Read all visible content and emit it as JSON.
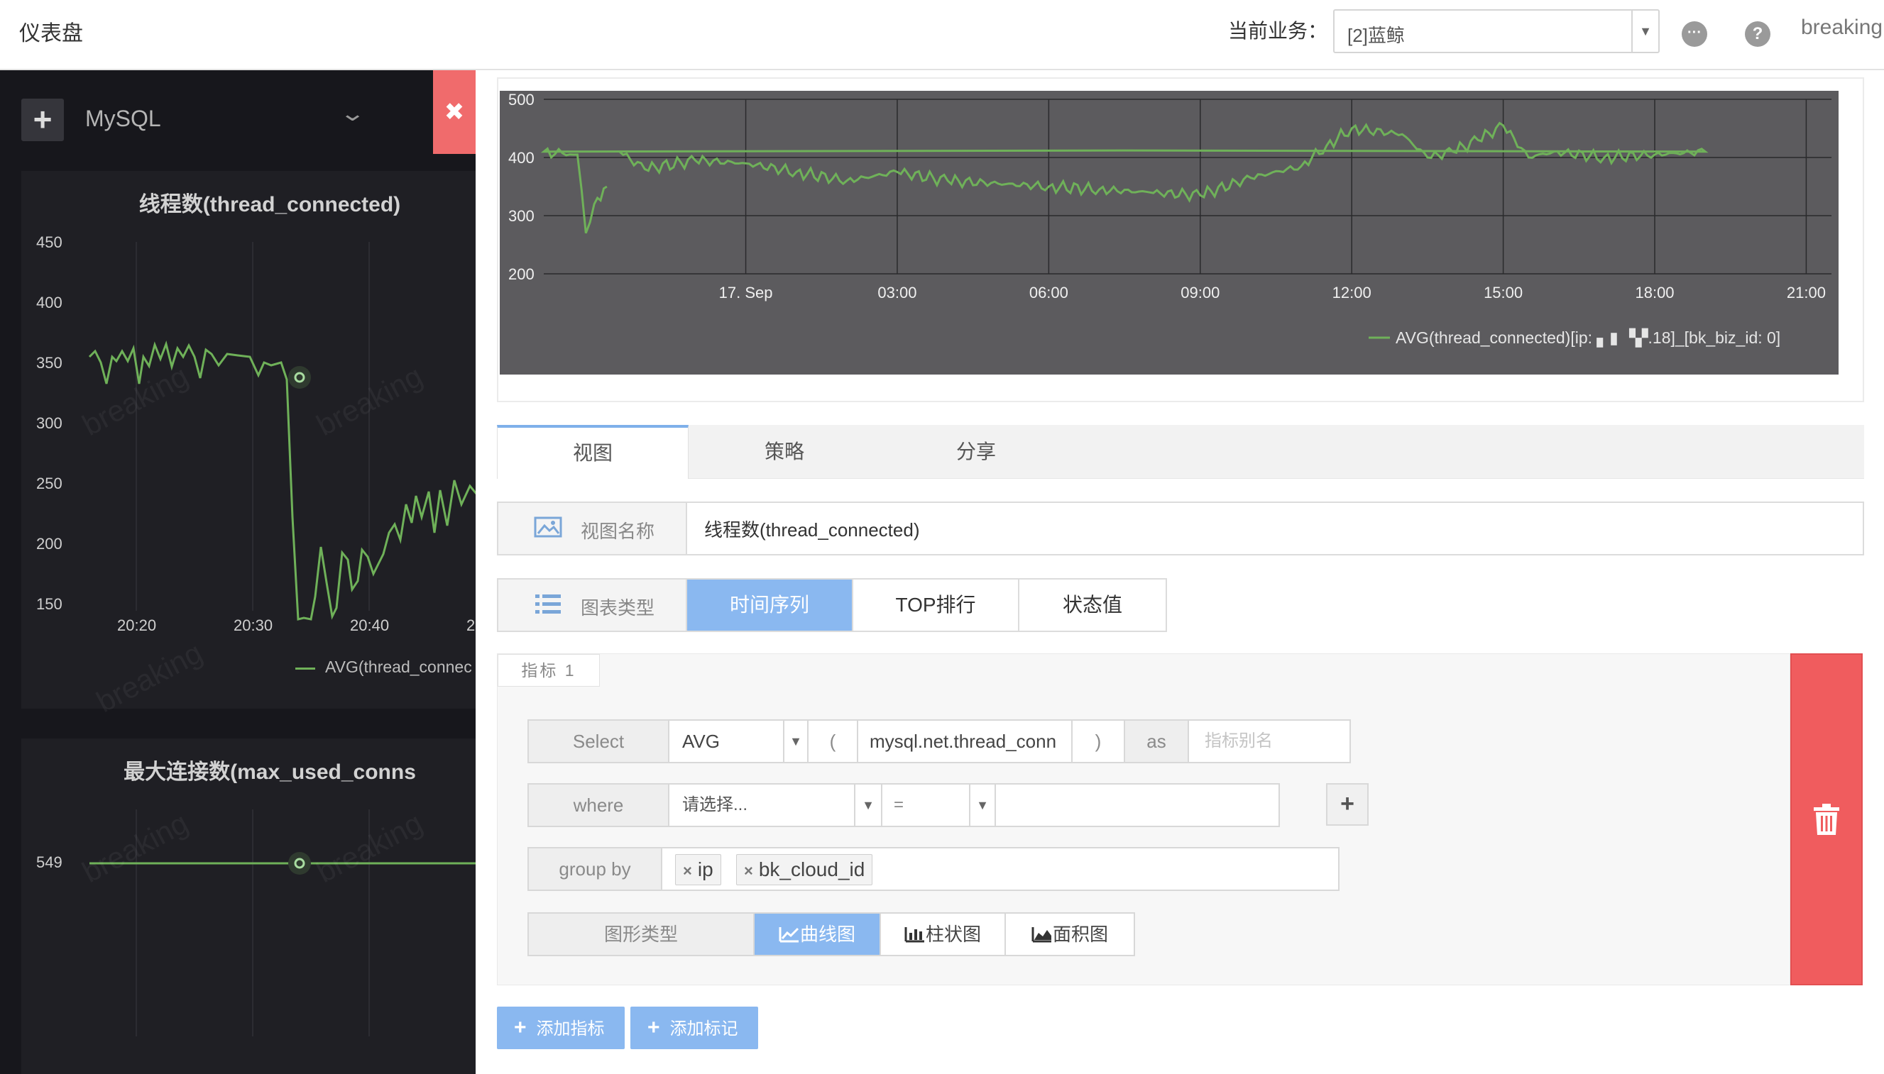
{
  "topbar": {
    "title": "仪表盘",
    "business_label": "当前业务：",
    "business_value": "[2]蓝鲸",
    "dropdown_arrow": "▼",
    "more_icon": "···",
    "help_icon": "?",
    "username": "breaking"
  },
  "left_panel": {
    "add_glyph": "+",
    "dashboard_name": "MySQL",
    "chevron": "⌄",
    "close_glyph": "✖",
    "watermark": "breaking",
    "card1": {
      "title": "线程数(thread_connected)",
      "y_ticks": [
        "450",
        "400",
        "350",
        "300",
        "250",
        "200",
        "150"
      ],
      "x_ticks": [
        "20:20",
        "20:30",
        "20:40",
        "2"
      ],
      "legend": "AVG(thread_connec"
    },
    "card2": {
      "title": "最大连接数(max_used_conns",
      "y_tick": "549"
    }
  },
  "chart_data": {
    "type": "line",
    "y_ticks": [
      "500",
      "400",
      "300",
      "200"
    ],
    "x_ticks": [
      "17. Sep",
      "03:00",
      "06:00",
      "09:00",
      "12:00",
      "15:00",
      "18:00",
      "21:00"
    ],
    "ylim": [
      200,
      500
    ],
    "grid": true,
    "legend_position": "bottom-right",
    "series_color": "#6fb159",
    "series": [
      {
        "name": "AVG(thread_connected)[ip: ▖▮ ▝▞.18]_[bk_biz_id: 0]",
        "x": [
          "21:30",
          "22:00",
          "23:00",
          "00:00",
          "01:00",
          "02:00",
          "03:00",
          "04:00",
          "05:00",
          "06:00",
          "07:00",
          "08:00",
          "09:00",
          "10:00",
          "11:00",
          "11:30",
          "12:00",
          "13:00",
          "13:30",
          "14:00",
          "14:30",
          "15:00",
          "15:30",
          "16:00",
          "17:00",
          "18:00",
          "19:00",
          "20:00",
          "20:40",
          "20:50",
          "21:00",
          "21:15"
        ],
        "values": [
          410,
          380,
          395,
          390,
          375,
          360,
          375,
          360,
          355,
          350,
          345,
          340,
          335,
          365,
          385,
          420,
          450,
          440,
          400,
          410,
          430,
          455,
          400,
          410,
          400,
          405,
          410,
          410,
          405,
          270,
          320,
          350
        ]
      }
    ]
  },
  "tabs": [
    "视图",
    "策略",
    "分享"
  ],
  "view_name": {
    "label": "视图名称",
    "value": "线程数(thread_connected)"
  },
  "chart_type": {
    "label": "图表类型",
    "options": [
      "时间序列",
      "TOP排行",
      "状态值"
    ]
  },
  "metric": {
    "tab_label": "指标 1",
    "select_row": {
      "label": "Select",
      "agg": "AVG",
      "open_paren": "(",
      "field": "mysql.net.thread_conn",
      "close_paren": ")",
      "as": "as",
      "alias_placeholder": "指标别名"
    },
    "where_row": {
      "label": "where",
      "field_placeholder": "请选择...",
      "operator": "=",
      "add_glyph": "+"
    },
    "group_by": {
      "label": "group by",
      "tags": [
        "ip",
        "bk_cloud_id"
      ],
      "remove_glyph": "×"
    },
    "graph_type": {
      "label": "图形类型",
      "options": [
        "曲线图",
        "柱状图",
        "面积图"
      ]
    }
  },
  "buttons": {
    "add_metric": "添加指标",
    "add_mark": "添加标记",
    "plus_glyph": "+"
  },
  "colors": {
    "accent": "#8ab8f0",
    "danger": "#f05c5e",
    "line": "#6fb159",
    "chart_bg": "#5c5b5e"
  }
}
